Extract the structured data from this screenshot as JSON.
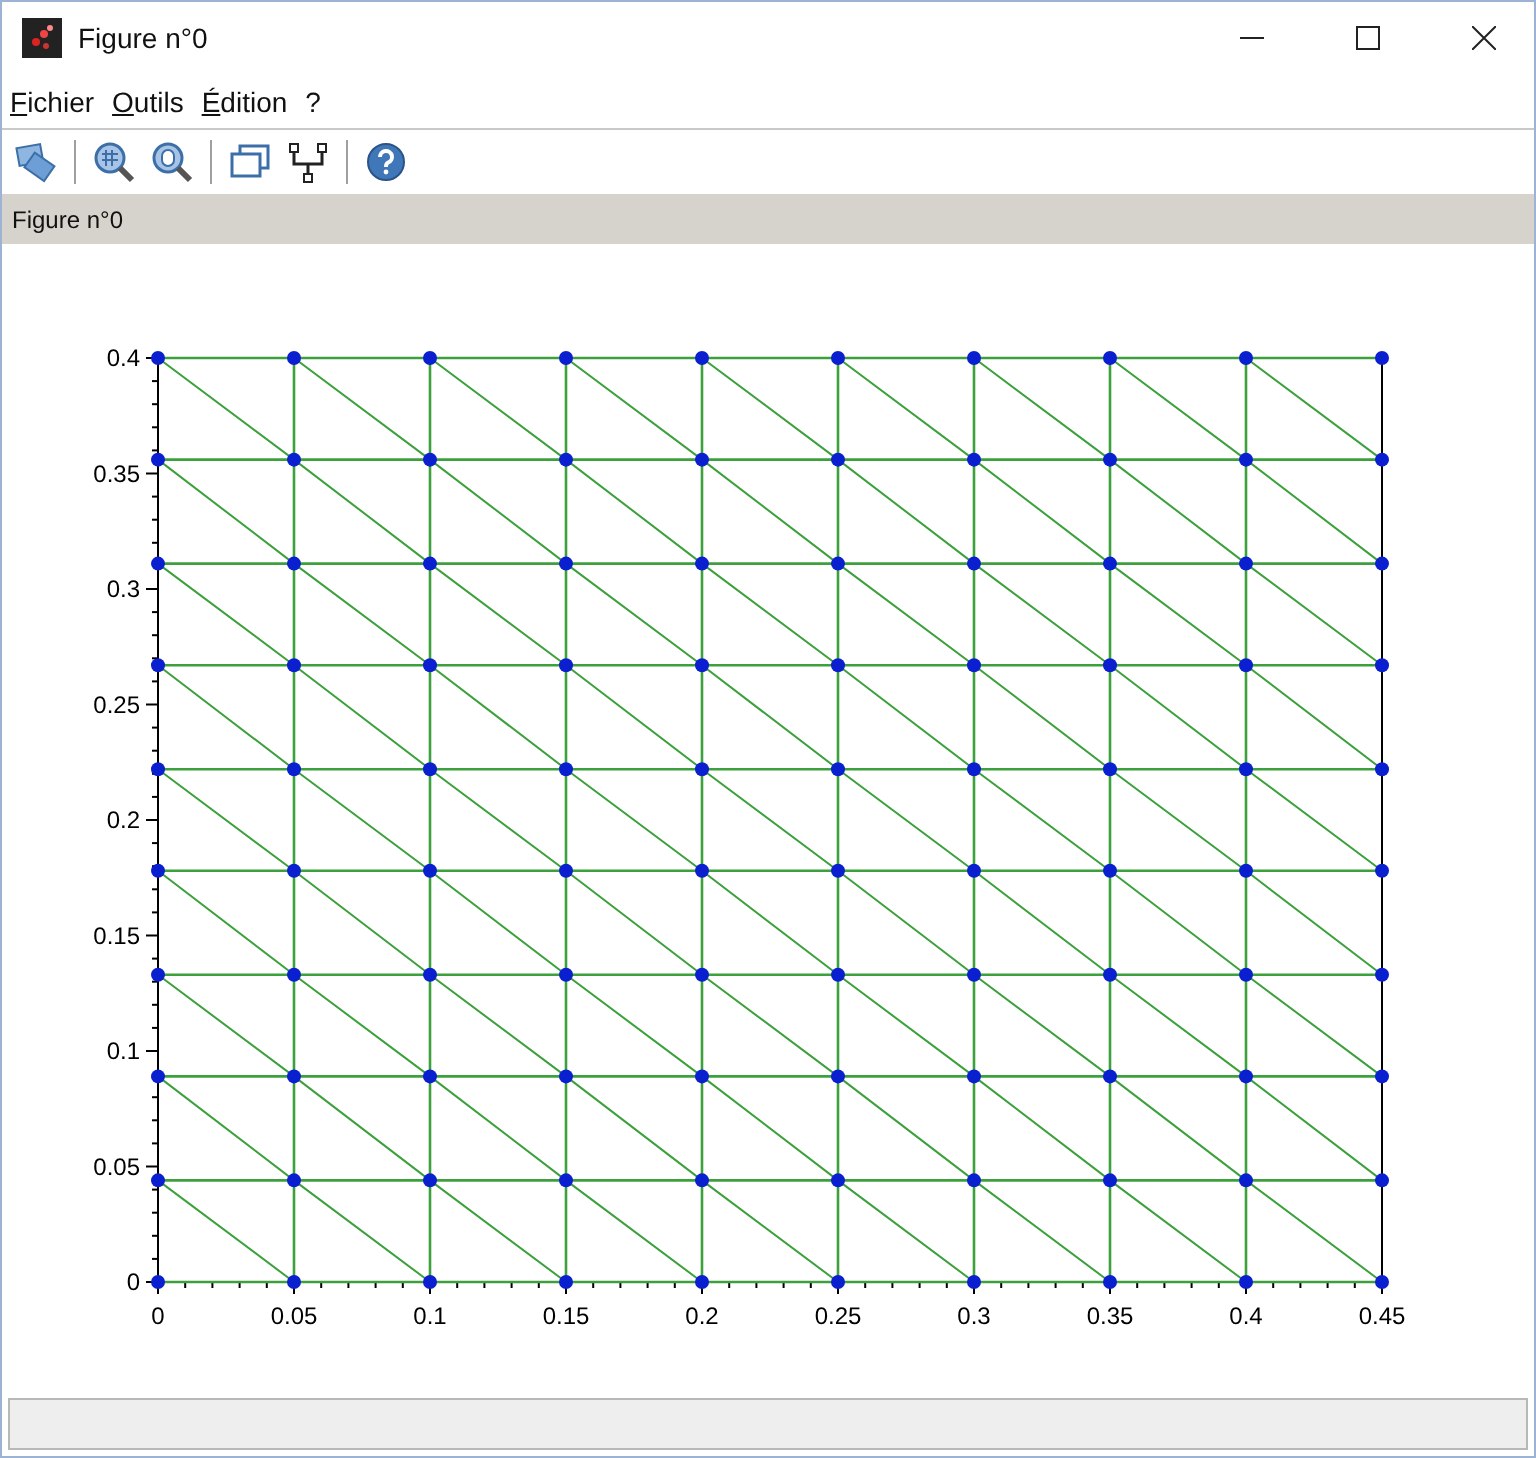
{
  "window": {
    "title": "Figure n°0"
  },
  "menu": [
    {
      "label": "Fichier"
    },
    {
      "label": "Outils"
    },
    {
      "label": "Édition"
    },
    {
      "label": "?"
    }
  ],
  "toolbar": [
    {
      "kind": "button"
    },
    {
      "kind": "separator"
    },
    {
      "kind": "button"
    },
    {
      "kind": "button"
    },
    {
      "kind": "separator"
    },
    {
      "kind": "button"
    },
    {
      "kind": "button"
    },
    {
      "kind": "separator"
    },
    {
      "kind": "button"
    }
  ],
  "figure_header": "Figure n°0",
  "plot": {
    "chart_data": {
      "type": "line",
      "x": [
        0,
        0.05,
        0.1,
        0.15,
        0.2,
        0.25,
        0.3,
        0.35,
        0.4,
        0.45
      ],
      "xlim": [
        0,
        0.45
      ],
      "ylim": [
        0,
        0.4
      ],
      "xticks": [
        0,
        {
          "value": 0.05,
          "label": "0.05"
        },
        {
          "value": 0.1,
          "label": "0.1"
        },
        {
          "value": 0.15,
          "label": "0.15"
        },
        {
          "value": 0.2,
          "label": "0.2"
        },
        {
          "value": 0.25,
          "label": "0.25"
        },
        {
          "value": 0.3,
          "label": "0.3"
        },
        {
          "value": 0.35,
          "label": "0.35"
        },
        {
          "value": 0.4,
          "label": "0.4"
        },
        {
          "value": 0.45,
          "label": "0.45"
        }
      ],
      "yticks": [
        0,
        {
          "value": 0.05,
          "label": "0.05"
        },
        {
          "value": 0.1,
          "label": "0.1"
        },
        {
          "value": 0.15,
          "label": "0.15"
        },
        {
          "value": 0.2,
          "label": "0.2"
        },
        {
          "value": 0.25,
          "label": "0.25"
        },
        {
          "value": 0.3,
          "label": "0.3"
        },
        {
          "value": 0.35,
          "label": "0.35"
        },
        {
          "value": 0.4,
          "label": "0.4"
        }
      ],
      "series": [
        {
          "color": "#3ca03c",
          "marker": "circle",
          "values": [
            0,
            0,
            0,
            0,
            0,
            0,
            0,
            0,
            0,
            0
          ]
        },
        {
          "color": "#3ca03c",
          "marker": "circle",
          "values": [
            0.044,
            0.044,
            0.044,
            0.044,
            0.044,
            0.044,
            0.044,
            0.044,
            0.044,
            0.044
          ]
        },
        {
          "color": "#3ca03c",
          "marker": "circle",
          "values": [
            0.089,
            0.089,
            0.089,
            0.089,
            0.089,
            0.089,
            0.089,
            0.089,
            0.089,
            0.089
          ]
        },
        {
          "color": "#3ca03c",
          "marker": "circle",
          "values": [
            0.133,
            0.133,
            0.133,
            0.133,
            0.133,
            0.133,
            0.133,
            0.133,
            0.133,
            0.133
          ]
        },
        {
          "color": "#3ca03c",
          "marker": "circle",
          "values": [
            0.178,
            0.178,
            0.178,
            0.178,
            0.178,
            0.178,
            0.178,
            0.178,
            0.178,
            0.178
          ]
        },
        {
          "color": "#3ca03c",
          "marker": "circle",
          "values": [
            0.222,
            0.222,
            0.222,
            0.222,
            0.222,
            0.222,
            0.222,
            0.222,
            0.222,
            0.222
          ]
        },
        {
          "color": "#3ca03c",
          "marker": "circle",
          "values": [
            0.267,
            0.267,
            0.267,
            0.267,
            0.267,
            0.267,
            0.267,
            0.267,
            0.267,
            0.267
          ]
        },
        {
          "color": "#3ca03c",
          "marker": "circle",
          "values": [
            0.311,
            0.311,
            0.311,
            0.311,
            0.311,
            0.311,
            0.311,
            0.311,
            0.311,
            0.311
          ]
        },
        {
          "color": "#3ca03c",
          "marker": "circle",
          "values": [
            0.356,
            0.356,
            0.356,
            0.356,
            0.356,
            0.356,
            0.356,
            0.356,
            0.356,
            0.356
          ]
        },
        {
          "color": "#3ca03c",
          "marker": "circle",
          "values": [
            0.4,
            0.4,
            0.4,
            0.4,
            0.4,
            0.4,
            0.4,
            0.4,
            0.4,
            0.4
          ]
        },
        {
          "color": "#3ca03c",
          "values": [
            0.044,
            0,
            null,
            null,
            null,
            null,
            null,
            null,
            null,
            null
          ]
        },
        {
          "color": "#3ca03c",
          "values": [
            0.089,
            0.044,
            0,
            null,
            null,
            null,
            null,
            null,
            null,
            null
          ]
        },
        {
          "color": "#3ca03c",
          "values": [
            0.133,
            0.089,
            0.044,
            0,
            null,
            null,
            null,
            null,
            null,
            null
          ]
        },
        {
          "color": "#3ca03c",
          "values": [
            0.178,
            0.133,
            0.089,
            0.044,
            0,
            null,
            null,
            null,
            null,
            null
          ]
        },
        {
          "color": "#3ca03c",
          "values": [
            0.222,
            0.178,
            0.133,
            0.089,
            0.044,
            0,
            null,
            null,
            null,
            null
          ]
        },
        {
          "color": "#3ca03c",
          "values": [
            0.267,
            0.222,
            0.178,
            0.133,
            0.089,
            0.044,
            0,
            null,
            null,
            null
          ]
        },
        {
          "color": "#3ca03c",
          "values": [
            0.311,
            0.267,
            0.222,
            0.178,
            0.133,
            0.089,
            0.044,
            0,
            null,
            null
          ]
        },
        {
          "color": "#3ca03c",
          "values": [
            0.356,
            0.311,
            0.267,
            0.222,
            0.178,
            0.133,
            0.089,
            0.044,
            0,
            null
          ]
        },
        {
          "color": "#3ca03c",
          "values": [
            0.4,
            0.356,
            0.311,
            0.267,
            0.222,
            0.178,
            0.133,
            0.089,
            0.044,
            0
          ]
        },
        {
          "color": "#3ca03c",
          "values": [
            null,
            0.4,
            0.356,
            0.311,
            0.267,
            0.222,
            0.178,
            0.133,
            0.089,
            0.044
          ]
        },
        {
          "color": "#3ca03c",
          "values": [
            null,
            null,
            0.4,
            0.356,
            0.311,
            0.267,
            0.222,
            0.178,
            0.133,
            0.089
          ]
        },
        {
          "color": "#3ca03c",
          "values": [
            null,
            null,
            null,
            0.4,
            0.356,
            0.311,
            0.267,
            0.222,
            0.178,
            0.133
          ]
        },
        {
          "color": "#3ca03c",
          "values": [
            null,
            null,
            null,
            null,
            0.4,
            0.356,
            0.311,
            0.267,
            0.222,
            0.178
          ]
        },
        {
          "color": "#3ca03c",
          "values": [
            null,
            null,
            null,
            null,
            null,
            0.4,
            0.356,
            0.311,
            0.267,
            0.222
          ]
        },
        {
          "color": "#3ca03c",
          "values": [
            null,
            null,
            null,
            null,
            null,
            null,
            0.4,
            0.356,
            0.311,
            0.267
          ]
        },
        {
          "color": "#3ca03c",
          "values": [
            null,
            null,
            null,
            null,
            null,
            null,
            null,
            0.4,
            0.356,
            0.311
          ]
        },
        {
          "color": "#3ca03c",
          "values": [
            null,
            null,
            null,
            null,
            null,
            null,
            null,
            null,
            0.4,
            0.356
          ]
        }
      ],
      "ref_lines": [
        {
          "axis": "x",
          "value": 0.05,
          "color": "#3ca03c"
        },
        {
          "axis": "x",
          "value": 0.1,
          "color": "#3ca03c"
        },
        {
          "axis": "x",
          "value": 0.15,
          "color": "#3ca03c"
        },
        {
          "axis": "x",
          "value": 0.2,
          "color": "#3ca03c"
        },
        {
          "axis": "x",
          "value": 0.25,
          "color": "#3ca03c"
        },
        {
          "axis": "x",
          "value": 0.3,
          "color": "#3ca03c"
        },
        {
          "axis": "x",
          "value": 0.35,
          "color": "#3ca03c"
        },
        {
          "axis": "x",
          "value": 0.4,
          "color": "#3ca03c"
        }
      ]
    }
  }
}
